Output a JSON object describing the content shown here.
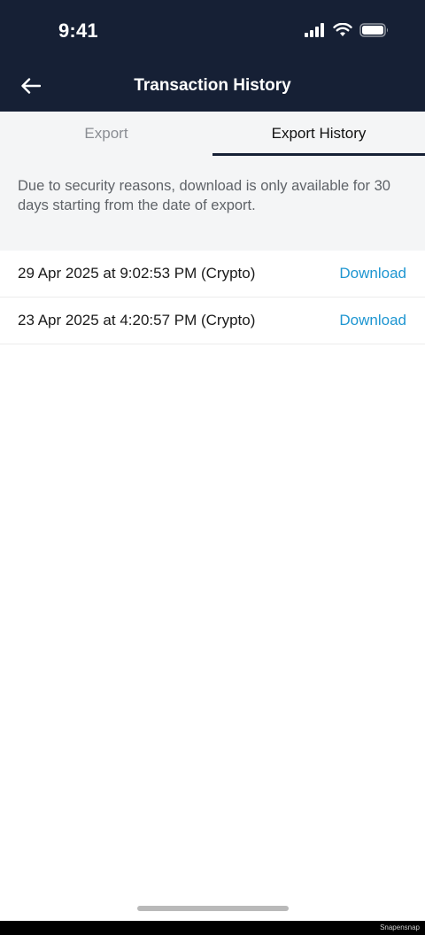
{
  "status_bar": {
    "time": "9:41"
  },
  "header": {
    "title": "Transaction History",
    "back_icon": "back-arrow-icon"
  },
  "tabs": [
    {
      "label": "Export",
      "active": false
    },
    {
      "label": "Export History",
      "active": true
    }
  ],
  "notice": {
    "text": "Due to security reasons, download is only available for 30 days starting from the date of export."
  },
  "history_items": [
    {
      "label": "29 Apr 2025 at 9:02:53 PM (Crypto)",
      "action": "Download"
    },
    {
      "label": "23 Apr 2025 at 4:20:57 PM (Crypto)",
      "action": "Download"
    }
  ],
  "watermark": "Snapensnap",
  "colors": {
    "header_bg": "#162035",
    "link": "#1e96d1",
    "tab_strip_bg": "#f4f5f6"
  }
}
